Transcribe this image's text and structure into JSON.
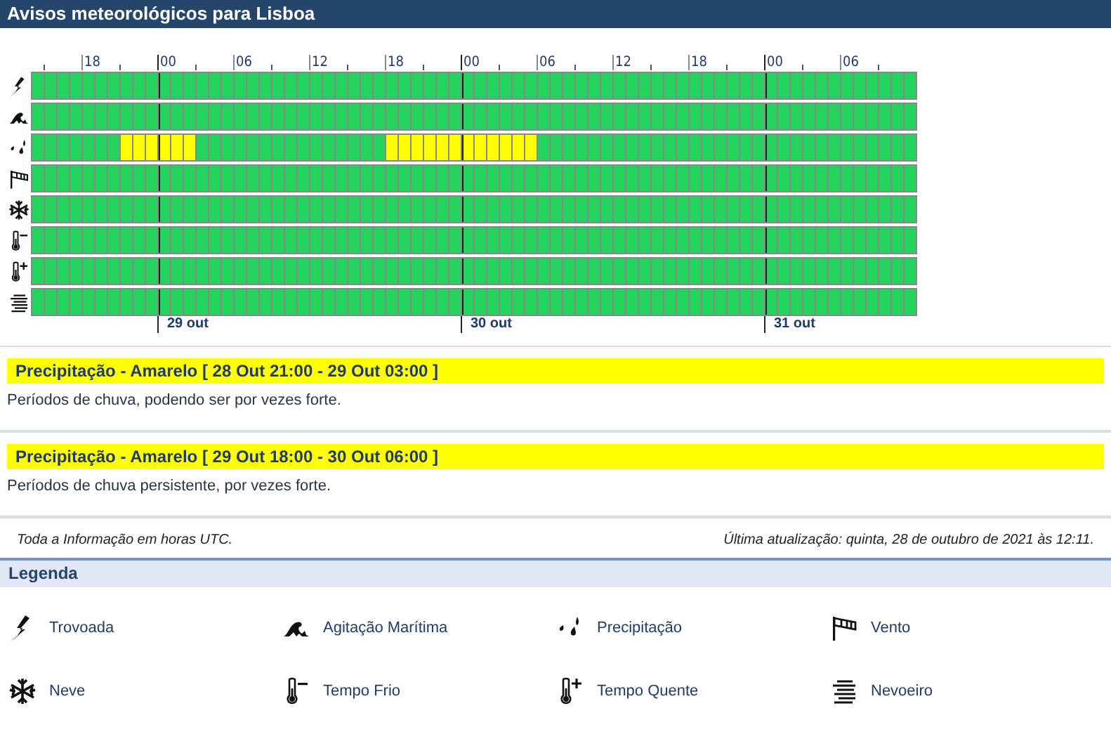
{
  "header": {
    "title": "Avisos meteorológicos para Lisboa"
  },
  "timeline": {
    "hour_labels": [
      "18",
      "00",
      "06",
      "12",
      "18",
      "00",
      "06",
      "12",
      "18",
      "00",
      "06"
    ],
    "days": [
      "29 out",
      "30 out",
      "31 out"
    ],
    "rows": [
      {
        "kind": "thunderstorm",
        "cells": [
          {
            "color": "#27d35f"
          },
          {
            "color": "#27d35f"
          },
          {
            "color": "#27d35f"
          },
          {
            "color": "#27d35f"
          },
          {
            "color": "#27d35f"
          },
          {
            "color": "#27d35f"
          },
          {
            "color": "#27d35f"
          },
          {
            "color": "#27d35f"
          },
          {
            "color": "#27d35f"
          },
          {
            "color": "#27d35f"
          },
          {
            "color": "#27d35f"
          },
          {
            "color": "#27d35f"
          },
          {
            "color": "#27d35f"
          },
          {
            "color": "#27d35f"
          },
          {
            "color": "#27d35f"
          },
          {
            "color": "#27d35f"
          },
          {
            "color": "#27d35f"
          },
          {
            "color": "#27d35f"
          },
          {
            "color": "#27d35f"
          },
          {
            "color": "#27d35f"
          },
          {
            "color": "#27d35f"
          },
          {
            "color": "#27d35f"
          },
          {
            "color": "#27d35f"
          },
          {
            "color": "#27d35f"
          },
          {
            "color": "#27d35f"
          },
          {
            "color": "#27d35f"
          },
          {
            "color": "#27d35f"
          },
          {
            "color": "#27d35f"
          },
          {
            "color": "#27d35f"
          },
          {
            "color": "#27d35f"
          },
          {
            "color": "#27d35f"
          },
          {
            "color": "#27d35f"
          },
          {
            "color": "#27d35f"
          },
          {
            "color": "#27d35f"
          },
          {
            "color": "#27d35f"
          },
          {
            "color": "#27d35f"
          },
          {
            "color": "#27d35f"
          },
          {
            "color": "#27d35f"
          },
          {
            "color": "#27d35f"
          },
          {
            "color": "#27d35f"
          },
          {
            "color": "#27d35f"
          },
          {
            "color": "#27d35f"
          },
          {
            "color": "#27d35f"
          },
          {
            "color": "#27d35f"
          },
          {
            "color": "#27d35f"
          },
          {
            "color": "#27d35f"
          },
          {
            "color": "#27d35f"
          },
          {
            "color": "#27d35f"
          },
          {
            "color": "#27d35f"
          },
          {
            "color": "#27d35f"
          },
          {
            "color": "#27d35f"
          },
          {
            "color": "#27d35f"
          },
          {
            "color": "#27d35f"
          },
          {
            "color": "#27d35f"
          },
          {
            "color": "#27d35f"
          },
          {
            "color": "#27d35f"
          },
          {
            "color": "#27d35f"
          },
          {
            "color": "#27d35f"
          },
          {
            "color": "#27d35f"
          },
          {
            "color": "#27d35f"
          },
          {
            "color": "#27d35f"
          },
          {
            "color": "#27d35f"
          },
          {
            "color": "#27d35f"
          },
          {
            "color": "#27d35f"
          },
          {
            "color": "#27d35f"
          },
          {
            "color": "#27d35f"
          },
          {
            "color": "#27d35f"
          },
          {
            "color": "#27d35f"
          },
          {
            "color": "#27d35f"
          },
          {
            "color": "#27d35f"
          }
        ]
      },
      {
        "kind": "sea",
        "cells": [
          {
            "color": "#27d35f"
          },
          {
            "color": "#27d35f"
          },
          {
            "color": "#27d35f"
          },
          {
            "color": "#27d35f"
          },
          {
            "color": "#27d35f"
          },
          {
            "color": "#27d35f"
          },
          {
            "color": "#27d35f"
          },
          {
            "color": "#27d35f"
          },
          {
            "color": "#27d35f"
          },
          {
            "color": "#27d35f"
          },
          {
            "color": "#27d35f"
          },
          {
            "color": "#27d35f"
          },
          {
            "color": "#27d35f"
          },
          {
            "color": "#27d35f"
          },
          {
            "color": "#27d35f"
          },
          {
            "color": "#27d35f"
          },
          {
            "color": "#27d35f"
          },
          {
            "color": "#27d35f"
          },
          {
            "color": "#27d35f"
          },
          {
            "color": "#27d35f"
          },
          {
            "color": "#27d35f"
          },
          {
            "color": "#27d35f"
          },
          {
            "color": "#27d35f"
          },
          {
            "color": "#27d35f"
          },
          {
            "color": "#27d35f"
          },
          {
            "color": "#27d35f"
          },
          {
            "color": "#27d35f"
          },
          {
            "color": "#27d35f"
          },
          {
            "color": "#27d35f"
          },
          {
            "color": "#27d35f"
          },
          {
            "color": "#27d35f"
          },
          {
            "color": "#27d35f"
          },
          {
            "color": "#27d35f"
          },
          {
            "color": "#27d35f"
          },
          {
            "color": "#27d35f"
          },
          {
            "color": "#27d35f"
          },
          {
            "color": "#27d35f"
          },
          {
            "color": "#27d35f"
          },
          {
            "color": "#27d35f"
          },
          {
            "color": "#27d35f"
          },
          {
            "color": "#27d35f"
          },
          {
            "color": "#27d35f"
          },
          {
            "color": "#27d35f"
          },
          {
            "color": "#27d35f"
          },
          {
            "color": "#27d35f"
          },
          {
            "color": "#27d35f"
          },
          {
            "color": "#27d35f"
          },
          {
            "color": "#27d35f"
          },
          {
            "color": "#27d35f"
          },
          {
            "color": "#27d35f"
          },
          {
            "color": "#27d35f"
          },
          {
            "color": "#27d35f"
          },
          {
            "color": "#27d35f"
          },
          {
            "color": "#27d35f"
          },
          {
            "color": "#27d35f"
          },
          {
            "color": "#27d35f"
          },
          {
            "color": "#27d35f"
          },
          {
            "color": "#27d35f"
          },
          {
            "color": "#27d35f"
          },
          {
            "color": "#27d35f"
          },
          {
            "color": "#27d35f"
          },
          {
            "color": "#27d35f"
          },
          {
            "color": "#27d35f"
          },
          {
            "color": "#27d35f"
          },
          {
            "color": "#27d35f"
          },
          {
            "color": "#27d35f"
          },
          {
            "color": "#27d35f"
          },
          {
            "color": "#27d35f"
          },
          {
            "color": "#27d35f"
          },
          {
            "color": "#27d35f"
          }
        ]
      },
      {
        "kind": "rain",
        "cells": [
          {
            "color": "#27d35f"
          },
          {
            "color": "#27d35f"
          },
          {
            "color": "#27d35f"
          },
          {
            "color": "#27d35f"
          },
          {
            "color": "#27d35f"
          },
          {
            "color": "#27d35f"
          },
          {
            "color": "#27d35f"
          },
          {
            "color": "#ffff00"
          },
          {
            "color": "#ffff00"
          },
          {
            "color": "#ffff00"
          },
          {
            "color": "#ffff00"
          },
          {
            "color": "#ffff00"
          },
          {
            "color": "#ffff00"
          },
          {
            "color": "#27d35f"
          },
          {
            "color": "#27d35f"
          },
          {
            "color": "#27d35f"
          },
          {
            "color": "#27d35f"
          },
          {
            "color": "#27d35f"
          },
          {
            "color": "#27d35f"
          },
          {
            "color": "#27d35f"
          },
          {
            "color": "#27d35f"
          },
          {
            "color": "#27d35f"
          },
          {
            "color": "#27d35f"
          },
          {
            "color": "#27d35f"
          },
          {
            "color": "#27d35f"
          },
          {
            "color": "#27d35f"
          },
          {
            "color": "#27d35f"
          },
          {
            "color": "#27d35f"
          },
          {
            "color": "#ffff00"
          },
          {
            "color": "#ffff00"
          },
          {
            "color": "#ffff00"
          },
          {
            "color": "#ffff00"
          },
          {
            "color": "#ffff00"
          },
          {
            "color": "#ffff00"
          },
          {
            "color": "#ffff00"
          },
          {
            "color": "#ffff00"
          },
          {
            "color": "#ffff00"
          },
          {
            "color": "#ffff00"
          },
          {
            "color": "#ffff00"
          },
          {
            "color": "#ffff00"
          },
          {
            "color": "#27d35f"
          },
          {
            "color": "#27d35f"
          },
          {
            "color": "#27d35f"
          },
          {
            "color": "#27d35f"
          },
          {
            "color": "#27d35f"
          },
          {
            "color": "#27d35f"
          },
          {
            "color": "#27d35f"
          },
          {
            "color": "#27d35f"
          },
          {
            "color": "#27d35f"
          },
          {
            "color": "#27d35f"
          },
          {
            "color": "#27d35f"
          },
          {
            "color": "#27d35f"
          },
          {
            "color": "#27d35f"
          },
          {
            "color": "#27d35f"
          },
          {
            "color": "#27d35f"
          },
          {
            "color": "#27d35f"
          },
          {
            "color": "#27d35f"
          },
          {
            "color": "#27d35f"
          },
          {
            "color": "#27d35f"
          },
          {
            "color": "#27d35f"
          },
          {
            "color": "#27d35f"
          },
          {
            "color": "#27d35f"
          },
          {
            "color": "#27d35f"
          },
          {
            "color": "#27d35f"
          },
          {
            "color": "#27d35f"
          },
          {
            "color": "#27d35f"
          },
          {
            "color": "#27d35f"
          },
          {
            "color": "#27d35f"
          },
          {
            "color": "#27d35f"
          },
          {
            "color": "#27d35f"
          }
        ]
      },
      {
        "kind": "wind",
        "cells": [
          {
            "color": "#27d35f"
          },
          {
            "color": "#27d35f"
          },
          {
            "color": "#27d35f"
          },
          {
            "color": "#27d35f"
          },
          {
            "color": "#27d35f"
          },
          {
            "color": "#27d35f"
          },
          {
            "color": "#27d35f"
          },
          {
            "color": "#27d35f"
          },
          {
            "color": "#27d35f"
          },
          {
            "color": "#27d35f"
          },
          {
            "color": "#27d35f"
          },
          {
            "color": "#27d35f"
          },
          {
            "color": "#27d35f"
          },
          {
            "color": "#27d35f"
          },
          {
            "color": "#27d35f"
          },
          {
            "color": "#27d35f"
          },
          {
            "color": "#27d35f"
          },
          {
            "color": "#27d35f"
          },
          {
            "color": "#27d35f"
          },
          {
            "color": "#27d35f"
          },
          {
            "color": "#27d35f"
          },
          {
            "color": "#27d35f"
          },
          {
            "color": "#27d35f"
          },
          {
            "color": "#27d35f"
          },
          {
            "color": "#27d35f"
          },
          {
            "color": "#27d35f"
          },
          {
            "color": "#27d35f"
          },
          {
            "color": "#27d35f"
          },
          {
            "color": "#27d35f"
          },
          {
            "color": "#27d35f"
          },
          {
            "color": "#27d35f"
          },
          {
            "color": "#27d35f"
          },
          {
            "color": "#27d35f"
          },
          {
            "color": "#27d35f"
          },
          {
            "color": "#27d35f"
          },
          {
            "color": "#27d35f"
          },
          {
            "color": "#27d35f"
          },
          {
            "color": "#27d35f"
          },
          {
            "color": "#27d35f"
          },
          {
            "color": "#27d35f"
          },
          {
            "color": "#27d35f"
          },
          {
            "color": "#27d35f"
          },
          {
            "color": "#27d35f"
          },
          {
            "color": "#27d35f"
          },
          {
            "color": "#27d35f"
          },
          {
            "color": "#27d35f"
          },
          {
            "color": "#27d35f"
          },
          {
            "color": "#27d35f"
          },
          {
            "color": "#27d35f"
          },
          {
            "color": "#27d35f"
          },
          {
            "color": "#27d35f"
          },
          {
            "color": "#27d35f"
          },
          {
            "color": "#27d35f"
          },
          {
            "color": "#27d35f"
          },
          {
            "color": "#27d35f"
          },
          {
            "color": "#27d35f"
          },
          {
            "color": "#27d35f"
          },
          {
            "color": "#27d35f"
          },
          {
            "color": "#27d35f"
          },
          {
            "color": "#27d35f"
          },
          {
            "color": "#27d35f"
          },
          {
            "color": "#27d35f"
          },
          {
            "color": "#27d35f"
          },
          {
            "color": "#27d35f"
          },
          {
            "color": "#27d35f"
          },
          {
            "color": "#27d35f"
          },
          {
            "color": "#27d35f"
          },
          {
            "color": "#27d35f"
          },
          {
            "color": "#27d35f"
          },
          {
            "color": "#27d35f"
          }
        ]
      },
      {
        "kind": "snow",
        "cells": [
          {
            "color": "#27d35f"
          },
          {
            "color": "#27d35f"
          },
          {
            "color": "#27d35f"
          },
          {
            "color": "#27d35f"
          },
          {
            "color": "#27d35f"
          },
          {
            "color": "#27d35f"
          },
          {
            "color": "#27d35f"
          },
          {
            "color": "#27d35f"
          },
          {
            "color": "#27d35f"
          },
          {
            "color": "#27d35f"
          },
          {
            "color": "#27d35f"
          },
          {
            "color": "#27d35f"
          },
          {
            "color": "#27d35f"
          },
          {
            "color": "#27d35f"
          },
          {
            "color": "#27d35f"
          },
          {
            "color": "#27d35f"
          },
          {
            "color": "#27d35f"
          },
          {
            "color": "#27d35f"
          },
          {
            "color": "#27d35f"
          },
          {
            "color": "#27d35f"
          },
          {
            "color": "#27d35f"
          },
          {
            "color": "#27d35f"
          },
          {
            "color": "#27d35f"
          },
          {
            "color": "#27d35f"
          },
          {
            "color": "#27d35f"
          },
          {
            "color": "#27d35f"
          },
          {
            "color": "#27d35f"
          },
          {
            "color": "#27d35f"
          },
          {
            "color": "#27d35f"
          },
          {
            "color": "#27d35f"
          },
          {
            "color": "#27d35f"
          },
          {
            "color": "#27d35f"
          },
          {
            "color": "#27d35f"
          },
          {
            "color": "#27d35f"
          },
          {
            "color": "#27d35f"
          },
          {
            "color": "#27d35f"
          },
          {
            "color": "#27d35f"
          },
          {
            "color": "#27d35f"
          },
          {
            "color": "#27d35f"
          },
          {
            "color": "#27d35f"
          },
          {
            "color": "#27d35f"
          },
          {
            "color": "#27d35f"
          },
          {
            "color": "#27d35f"
          },
          {
            "color": "#27d35f"
          },
          {
            "color": "#27d35f"
          },
          {
            "color": "#27d35f"
          },
          {
            "color": "#27d35f"
          },
          {
            "color": "#27d35f"
          },
          {
            "color": "#27d35f"
          },
          {
            "color": "#27d35f"
          },
          {
            "color": "#27d35f"
          },
          {
            "color": "#27d35f"
          },
          {
            "color": "#27d35f"
          },
          {
            "color": "#27d35f"
          },
          {
            "color": "#27d35f"
          },
          {
            "color": "#27d35f"
          },
          {
            "color": "#27d35f"
          },
          {
            "color": "#27d35f"
          },
          {
            "color": "#27d35f"
          },
          {
            "color": "#27d35f"
          },
          {
            "color": "#27d35f"
          },
          {
            "color": "#27d35f"
          },
          {
            "color": "#27d35f"
          },
          {
            "color": "#27d35f"
          },
          {
            "color": "#27d35f"
          },
          {
            "color": "#27d35f"
          },
          {
            "color": "#27d35f"
          },
          {
            "color": "#27d35f"
          },
          {
            "color": "#27d35f"
          },
          {
            "color": "#27d35f"
          }
        ]
      },
      {
        "kind": "cold",
        "cells": [
          {
            "color": "#27d35f"
          },
          {
            "color": "#27d35f"
          },
          {
            "color": "#27d35f"
          },
          {
            "color": "#27d35f"
          },
          {
            "color": "#27d35f"
          },
          {
            "color": "#27d35f"
          },
          {
            "color": "#27d35f"
          },
          {
            "color": "#27d35f"
          },
          {
            "color": "#27d35f"
          },
          {
            "color": "#27d35f"
          },
          {
            "color": "#27d35f"
          },
          {
            "color": "#27d35f"
          },
          {
            "color": "#27d35f"
          },
          {
            "color": "#27d35f"
          },
          {
            "color": "#27d35f"
          },
          {
            "color": "#27d35f"
          },
          {
            "color": "#27d35f"
          },
          {
            "color": "#27d35f"
          },
          {
            "color": "#27d35f"
          },
          {
            "color": "#27d35f"
          },
          {
            "color": "#27d35f"
          },
          {
            "color": "#27d35f"
          },
          {
            "color": "#27d35f"
          },
          {
            "color": "#27d35f"
          },
          {
            "color": "#27d35f"
          },
          {
            "color": "#27d35f"
          },
          {
            "color": "#27d35f"
          },
          {
            "color": "#27d35f"
          },
          {
            "color": "#27d35f"
          },
          {
            "color": "#27d35f"
          },
          {
            "color": "#27d35f"
          },
          {
            "color": "#27d35f"
          },
          {
            "color": "#27d35f"
          },
          {
            "color": "#27d35f"
          },
          {
            "color": "#27d35f"
          },
          {
            "color": "#27d35f"
          },
          {
            "color": "#27d35f"
          },
          {
            "color": "#27d35f"
          },
          {
            "color": "#27d35f"
          },
          {
            "color": "#27d35f"
          },
          {
            "color": "#27d35f"
          },
          {
            "color": "#27d35f"
          },
          {
            "color": "#27d35f"
          },
          {
            "color": "#27d35f"
          },
          {
            "color": "#27d35f"
          },
          {
            "color": "#27d35f"
          },
          {
            "color": "#27d35f"
          },
          {
            "color": "#27d35f"
          },
          {
            "color": "#27d35f"
          },
          {
            "color": "#27d35f"
          },
          {
            "color": "#27d35f"
          },
          {
            "color": "#27d35f"
          },
          {
            "color": "#27d35f"
          },
          {
            "color": "#27d35f"
          },
          {
            "color": "#27d35f"
          },
          {
            "color": "#27d35f"
          },
          {
            "color": "#27d35f"
          },
          {
            "color": "#27d35f"
          },
          {
            "color": "#27d35f"
          },
          {
            "color": "#27d35f"
          },
          {
            "color": "#27d35f"
          },
          {
            "color": "#27d35f"
          },
          {
            "color": "#27d35f"
          },
          {
            "color": "#27d35f"
          },
          {
            "color": "#27d35f"
          },
          {
            "color": "#27d35f"
          },
          {
            "color": "#27d35f"
          },
          {
            "color": "#27d35f"
          },
          {
            "color": "#27d35f"
          },
          {
            "color": "#27d35f"
          }
        ]
      },
      {
        "kind": "hot",
        "cells": [
          {
            "color": "#27d35f"
          },
          {
            "color": "#27d35f"
          },
          {
            "color": "#27d35f"
          },
          {
            "color": "#27d35f"
          },
          {
            "color": "#27d35f"
          },
          {
            "color": "#27d35f"
          },
          {
            "color": "#27d35f"
          },
          {
            "color": "#27d35f"
          },
          {
            "color": "#27d35f"
          },
          {
            "color": "#27d35f"
          },
          {
            "color": "#27d35f"
          },
          {
            "color": "#27d35f"
          },
          {
            "color": "#27d35f"
          },
          {
            "color": "#27d35f"
          },
          {
            "color": "#27d35f"
          },
          {
            "color": "#27d35f"
          },
          {
            "color": "#27d35f"
          },
          {
            "color": "#27d35f"
          },
          {
            "color": "#27d35f"
          },
          {
            "color": "#27d35f"
          },
          {
            "color": "#27d35f"
          },
          {
            "color": "#27d35f"
          },
          {
            "color": "#27d35f"
          },
          {
            "color": "#27d35f"
          },
          {
            "color": "#27d35f"
          },
          {
            "color": "#27d35f"
          },
          {
            "color": "#27d35f"
          },
          {
            "color": "#27d35f"
          },
          {
            "color": "#27d35f"
          },
          {
            "color": "#27d35f"
          },
          {
            "color": "#27d35f"
          },
          {
            "color": "#27d35f"
          },
          {
            "color": "#27d35f"
          },
          {
            "color": "#27d35f"
          },
          {
            "color": "#27d35f"
          },
          {
            "color": "#27d35f"
          },
          {
            "color": "#27d35f"
          },
          {
            "color": "#27d35f"
          },
          {
            "color": "#27d35f"
          },
          {
            "color": "#27d35f"
          },
          {
            "color": "#27d35f"
          },
          {
            "color": "#27d35f"
          },
          {
            "color": "#27d35f"
          },
          {
            "color": "#27d35f"
          },
          {
            "color": "#27d35f"
          },
          {
            "color": "#27d35f"
          },
          {
            "color": "#27d35f"
          },
          {
            "color": "#27d35f"
          },
          {
            "color": "#27d35f"
          },
          {
            "color": "#27d35f"
          },
          {
            "color": "#27d35f"
          },
          {
            "color": "#27d35f"
          },
          {
            "color": "#27d35f"
          },
          {
            "color": "#27d35f"
          },
          {
            "color": "#27d35f"
          },
          {
            "color": "#27d35f"
          },
          {
            "color": "#27d35f"
          },
          {
            "color": "#27d35f"
          },
          {
            "color": "#27d35f"
          },
          {
            "color": "#27d35f"
          },
          {
            "color": "#27d35f"
          },
          {
            "color": "#27d35f"
          },
          {
            "color": "#27d35f"
          },
          {
            "color": "#27d35f"
          },
          {
            "color": "#27d35f"
          },
          {
            "color": "#27d35f"
          },
          {
            "color": "#27d35f"
          },
          {
            "color": "#27d35f"
          },
          {
            "color": "#27d35f"
          },
          {
            "color": "#27d35f"
          }
        ]
      },
      {
        "kind": "fog",
        "cells": [
          {
            "color": "#27d35f"
          },
          {
            "color": "#27d35f"
          },
          {
            "color": "#27d35f"
          },
          {
            "color": "#27d35f"
          },
          {
            "color": "#27d35f"
          },
          {
            "color": "#27d35f"
          },
          {
            "color": "#27d35f"
          },
          {
            "color": "#27d35f"
          },
          {
            "color": "#27d35f"
          },
          {
            "color": "#27d35f"
          },
          {
            "color": "#27d35f"
          },
          {
            "color": "#27d35f"
          },
          {
            "color": "#27d35f"
          },
          {
            "color": "#27d35f"
          },
          {
            "color": "#27d35f"
          },
          {
            "color": "#27d35f"
          },
          {
            "color": "#27d35f"
          },
          {
            "color": "#27d35f"
          },
          {
            "color": "#27d35f"
          },
          {
            "color": "#27d35f"
          },
          {
            "color": "#27d35f"
          },
          {
            "color": "#27d35f"
          },
          {
            "color": "#27d35f"
          },
          {
            "color": "#27d35f"
          },
          {
            "color": "#27d35f"
          },
          {
            "color": "#27d35f"
          },
          {
            "color": "#27d35f"
          },
          {
            "color": "#27d35f"
          },
          {
            "color": "#27d35f"
          },
          {
            "color": "#27d35f"
          },
          {
            "color": "#27d35f"
          },
          {
            "color": "#27d35f"
          },
          {
            "color": "#27d35f"
          },
          {
            "color": "#27d35f"
          },
          {
            "color": "#27d35f"
          },
          {
            "color": "#27d35f"
          },
          {
            "color": "#27d35f"
          },
          {
            "color": "#27d35f"
          },
          {
            "color": "#27d35f"
          },
          {
            "color": "#27d35f"
          },
          {
            "color": "#27d35f"
          },
          {
            "color": "#27d35f"
          },
          {
            "color": "#27d35f"
          },
          {
            "color": "#27d35f"
          },
          {
            "color": "#27d35f"
          },
          {
            "color": "#27d35f"
          },
          {
            "color": "#27d35f"
          },
          {
            "color": "#27d35f"
          },
          {
            "color": "#27d35f"
          },
          {
            "color": "#27d35f"
          },
          {
            "color": "#27d35f"
          },
          {
            "color": "#27d35f"
          },
          {
            "color": "#27d35f"
          },
          {
            "color": "#27d35f"
          },
          {
            "color": "#27d35f"
          },
          {
            "color": "#27d35f"
          },
          {
            "color": "#27d35f"
          },
          {
            "color": "#27d35f"
          },
          {
            "color": "#27d35f"
          },
          {
            "color": "#27d35f"
          },
          {
            "color": "#27d35f"
          },
          {
            "color": "#27d35f"
          },
          {
            "color": "#27d35f"
          },
          {
            "color": "#27d35f"
          },
          {
            "color": "#27d35f"
          },
          {
            "color": "#27d35f"
          },
          {
            "color": "#27d35f"
          },
          {
            "color": "#27d35f"
          },
          {
            "color": "#27d35f"
          },
          {
            "color": "#27d35f"
          }
        ]
      }
    ]
  },
  "warnings": [
    {
      "color": "#ffff00",
      "title": "Precipitação - Amarelo [ 28 Out 21:00 - 29 Out 03:00 ]",
      "text": "Períodos de chuva, podendo ser por vezes forte."
    },
    {
      "color": "#ffff00",
      "title": "Precipitação - Amarelo [ 29 Out 18:00 - 30 Out 06:00 ]",
      "text": "Períodos de chuva persistente, por vezes forte."
    }
  ],
  "footer": {
    "note": "Toda a Informação em horas UTC.",
    "updated": "Última atualização: quinta, 28 de outubro de 2021 às 12:11."
  },
  "legend": {
    "title": "Legenda",
    "items": [
      {
        "kind": "thunderstorm",
        "label": "Trovoada"
      },
      {
        "kind": "sea",
        "label": "Agitação Marítima"
      },
      {
        "kind": "rain",
        "label": "Precipitação"
      },
      {
        "kind": "wind",
        "label": "Vento"
      },
      {
        "kind": "snow",
        "label": "Neve"
      },
      {
        "kind": "cold",
        "label": "Tempo Frio"
      },
      {
        "kind": "hot",
        "label": "Tempo Quente"
      },
      {
        "kind": "fog",
        "label": "Nevoeiro"
      }
    ]
  }
}
